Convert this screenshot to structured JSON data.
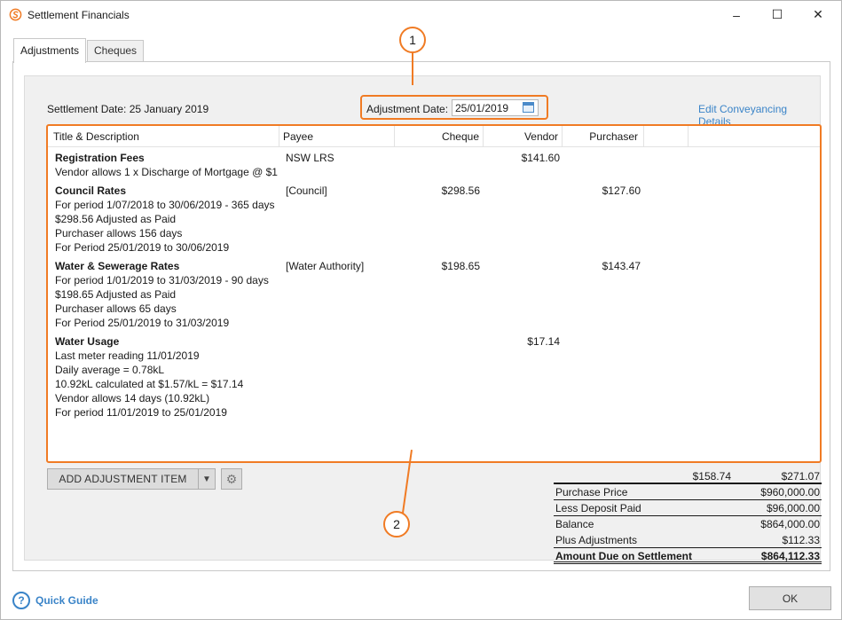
{
  "window": {
    "title": "Settlement Financials",
    "minimize": "–",
    "maximize": "☐",
    "close": "✕"
  },
  "tabs": [
    {
      "label": "Adjustments",
      "active": true
    },
    {
      "label": "Cheques",
      "active": false
    }
  ],
  "header": {
    "settlement_date": "Settlement Date: 25 January 2019",
    "adjustment_date_label": "Adjustment Date:",
    "adjustment_date_value": "25/01/2019",
    "edit_link": "Edit Conveyancing Details"
  },
  "grid": {
    "columns": [
      "Title & Description",
      "Payee",
      "Cheque",
      "Vendor",
      "Purchaser"
    ],
    "rows": [
      {
        "title": "Registration Fees",
        "lines": [
          "Vendor allows 1 x Discharge of Mortgage @ $1"
        ],
        "payee": "NSW LRS",
        "cheque": "",
        "vendor": "$141.60",
        "purchaser": ""
      },
      {
        "title": "Council Rates",
        "lines": [
          "For period 1/07/2018 to 30/06/2019 - 365 days",
          "$298.56 Adjusted as Paid",
          "Purchaser allows 156 days",
          "For Period 25/01/2019 to 30/06/2019"
        ],
        "payee": "[Council]",
        "cheque": "$298.56",
        "vendor": "",
        "purchaser": "$127.60"
      },
      {
        "title": "Water & Sewerage Rates",
        "lines": [
          "For period 1/01/2019 to 31/03/2019 - 90 days",
          "$198.65 Adjusted as Paid",
          "Purchaser allows 65 days",
          "For Period 25/01/2019 to 31/03/2019"
        ],
        "payee": "[Water Authority]",
        "cheque": "$198.65",
        "vendor": "",
        "purchaser": "$143.47"
      },
      {
        "title": "Water Usage",
        "lines": [
          "Last meter reading 11/01/2019",
          "Daily average = 0.78kL",
          "10.92kL calculated at $1.57/kL = $17.14",
          "Vendor allows 14 days (10.92kL)",
          "For period 11/01/2019 to 25/01/2019"
        ],
        "payee": "",
        "cheque": "",
        "vendor": "$17.14",
        "purchaser": ""
      }
    ]
  },
  "controls": {
    "add_button": "ADD ADJUSTMENT ITEM",
    "add_arrow": "▼",
    "gear": "⚙"
  },
  "totals": {
    "vendor": "$158.74",
    "purchaser": "$271.07"
  },
  "summary": [
    {
      "label": "Purchase Price",
      "value": "$960,000.00"
    },
    {
      "label": "Less Deposit Paid",
      "value": "$96,000.00"
    },
    {
      "label": "Balance",
      "value": "$864,000.00"
    },
    {
      "label": "Plus Adjustments",
      "value": "$112.33"
    },
    {
      "label": "Amount Due on Settlement",
      "value": "$864,112.33"
    }
  ],
  "callouts": {
    "one": "1",
    "two": "2"
  },
  "footer": {
    "quick_guide": "Quick Guide",
    "quick_guide_icon": "?",
    "ok": "OK"
  },
  "colors": {
    "accent_orange": "#f07b24",
    "link_blue": "#3a84c8"
  }
}
